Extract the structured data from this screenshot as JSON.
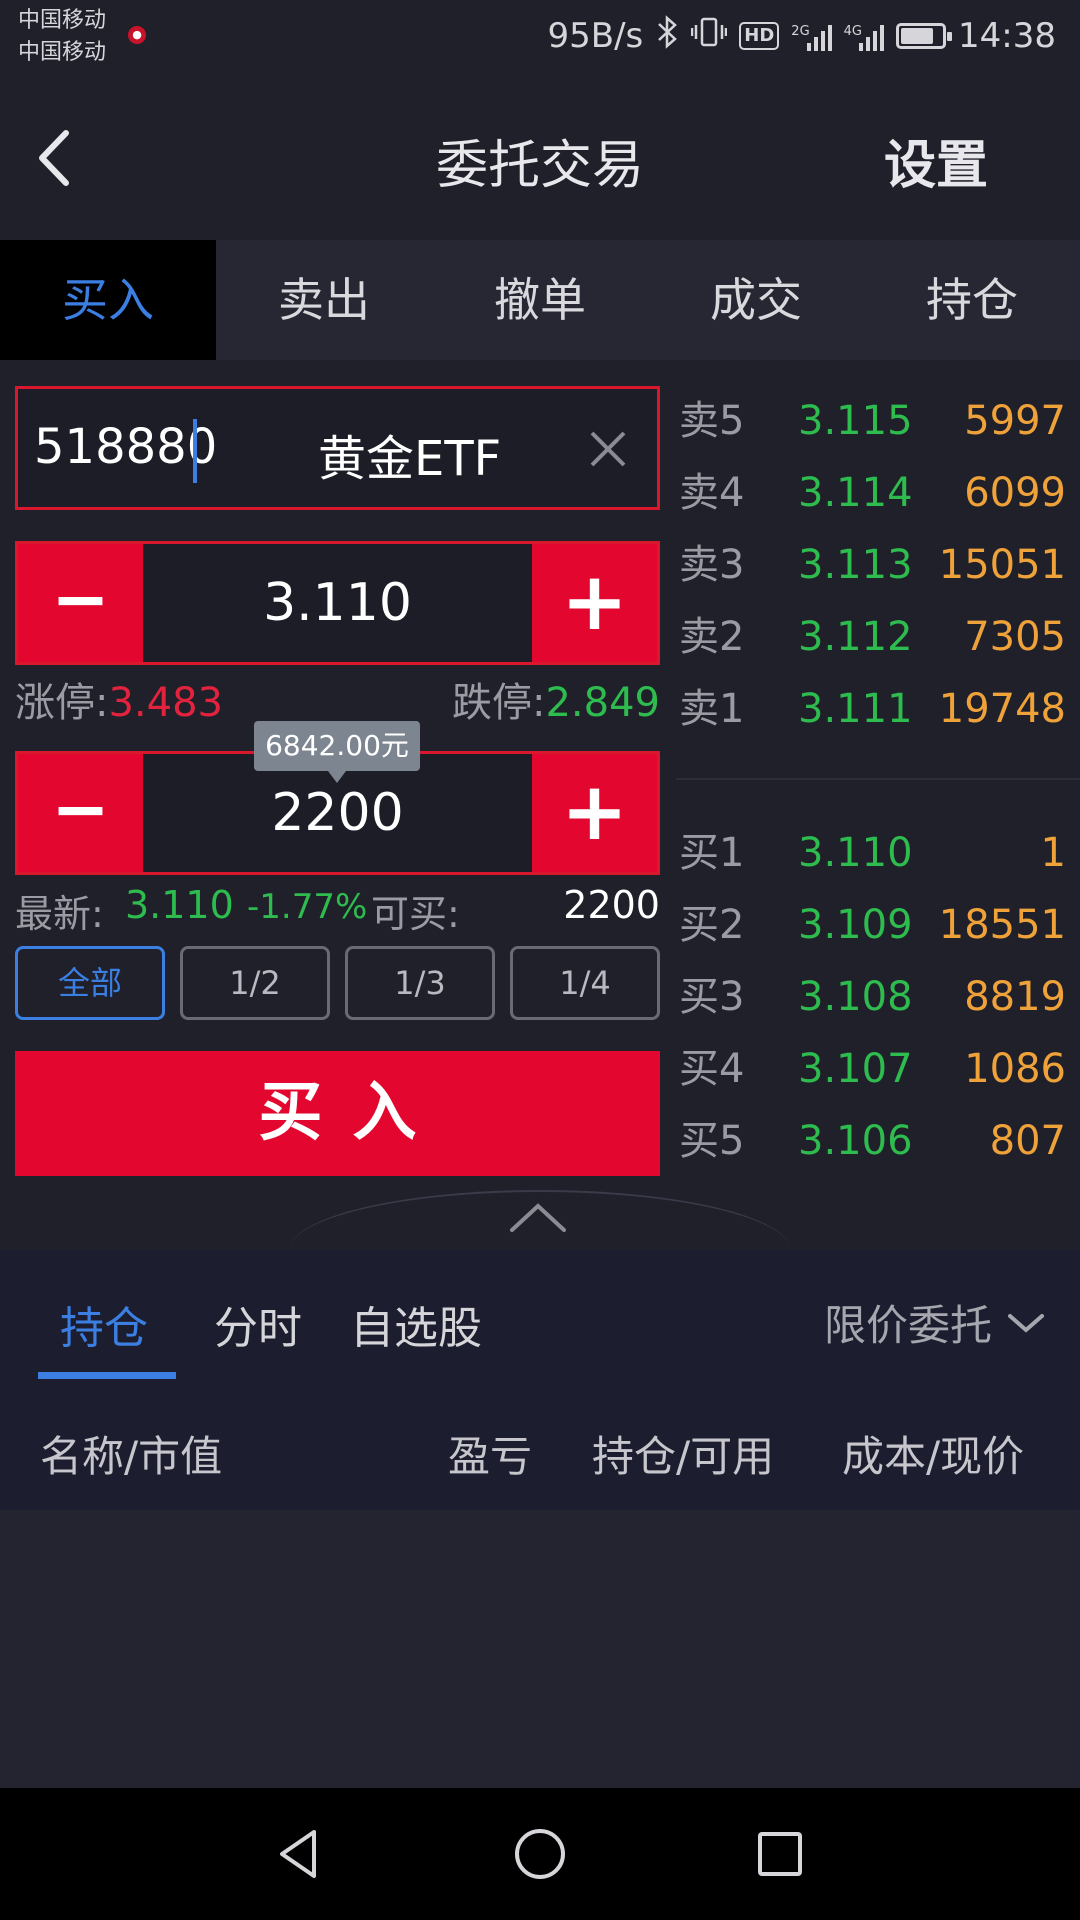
{
  "status_bar": {
    "carrier_1": "中国移动",
    "carrier_2": "中国移动",
    "net_speed": "95B/s",
    "hd": "HD",
    "net_2g": "2G",
    "net_4g": "4G",
    "time": "14:38",
    "battery_level": 0.8
  },
  "header": {
    "title": "委托交易",
    "settings_label": "设置",
    "back_icon": "chevron-left-icon"
  },
  "tabs": [
    {
      "label": "买入",
      "active": true
    },
    {
      "label": "卖出"
    },
    {
      "label": "撤单"
    },
    {
      "label": "成交"
    },
    {
      "label": "持仓"
    }
  ],
  "order_form": {
    "stock_code": "518880",
    "stock_name": "黄金ETF",
    "clear_icon": "close-icon",
    "price": "3.110",
    "limit_up_label": "涨停:",
    "limit_up_value": "3.483",
    "limit_down_label": "跌停:",
    "limit_down_value": "2.849",
    "amount_tooltip": "6842.00元",
    "quantity": "2200",
    "latest_label": "最新:",
    "latest_price": "3.110",
    "change_pct": "-1.77%",
    "available_label": "可买:",
    "available_qty": "2200",
    "ratio_buttons": [
      "全部",
      "1/2",
      "1/3",
      "1/4"
    ],
    "submit_label": "买入",
    "minus_symbol": "−",
    "plus_symbol": "+"
  },
  "order_book": {
    "asks": [
      {
        "label": "卖5",
        "price": "3.115",
        "volume": "5997"
      },
      {
        "label": "卖4",
        "price": "3.114",
        "volume": "6099"
      },
      {
        "label": "卖3",
        "price": "3.113",
        "volume": "15051"
      },
      {
        "label": "卖2",
        "price": "3.112",
        "volume": "7305"
      },
      {
        "label": "卖1",
        "price": "3.111",
        "volume": "19748"
      }
    ],
    "bids": [
      {
        "label": "买1",
        "price": "3.110",
        "volume": "1"
      },
      {
        "label": "买2",
        "price": "3.109",
        "volume": "18551"
      },
      {
        "label": "买3",
        "price": "3.108",
        "volume": "8819"
      },
      {
        "label": "买4",
        "price": "3.107",
        "volume": "1086"
      },
      {
        "label": "买5",
        "price": "3.106",
        "volume": "807"
      }
    ]
  },
  "bottom_panel": {
    "tabs": [
      "持仓",
      "分时",
      "自选股"
    ],
    "order_type": "限价委托",
    "columns": [
      "名称/市值",
      "盈亏",
      "持仓/可用",
      "成本/现价"
    ]
  },
  "colors": {
    "accent_blue": "#3b7fe3",
    "buy_red": "#e3072f",
    "price_green": "#2ebc4f",
    "volume_orange": "#f0a23a"
  }
}
